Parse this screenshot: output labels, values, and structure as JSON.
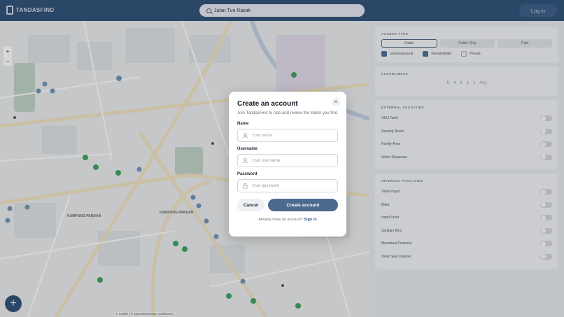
{
  "app": {
    "name": "TANDASFIND"
  },
  "header": {
    "search_value": "Jalan Tun Razak",
    "login_label": "Log in"
  },
  "map": {
    "zoom_in": "+",
    "zoom_out": "−",
    "add_label": "+",
    "attribution": "© Leaflet | © OpenStreetMap contributors",
    "place_labels": [
      "KAMPUNG PANDAN",
      "KAMPUNG PANDAN"
    ]
  },
  "sidebar": {
    "access_type": {
      "title": "ACCESS TYPE",
      "options": [
        "Public",
        "Public Only",
        "Paid"
      ],
      "selected": "Public"
    },
    "genders": [
      {
        "label": "Unisex/general",
        "checked": true
      },
      {
        "label": "Female/Male",
        "checked": true
      },
      {
        "label": "Private",
        "checked": false
      }
    ],
    "cleanliness": {
      "title": "CLEANLINESS",
      "stars": [
        "5",
        "4",
        "3",
        "2",
        "1",
        "Any"
      ]
    },
    "external": {
      "title": "EXTERNAL FACILITIES",
      "items": [
        "OKU Toilet",
        "Nursing Room",
        "Family Area",
        "Water Dispenser"
      ]
    },
    "internal": {
      "title": "INTERNAL FACILITIES",
      "items": [
        "Toilet Paper",
        "Bidet",
        "Hand Dryer",
        "Sanitary Bins",
        "Menstrual Products",
        "Toilet Seat Cleaner"
      ]
    }
  },
  "modal": {
    "title": "Create an account",
    "subtitle": "Join TandasFind to rate and review the toilets you find.",
    "close": "×",
    "fields": {
      "name": {
        "label": "Name",
        "placeholder": "Your name"
      },
      "username": {
        "label": "Username",
        "placeholder": "Your username"
      },
      "password": {
        "label": "Password",
        "placeholder": "Your password"
      }
    },
    "cancel_label": "Cancel",
    "create_label": "Create account",
    "signin_prompt": "Already have an account?",
    "signin_link": "Sign in"
  },
  "colors": {
    "header": "#2f4f73",
    "primary": "#4a6a8e",
    "pin_green": "#3f9a5a",
    "pin_blue": "#6d8fb0"
  }
}
